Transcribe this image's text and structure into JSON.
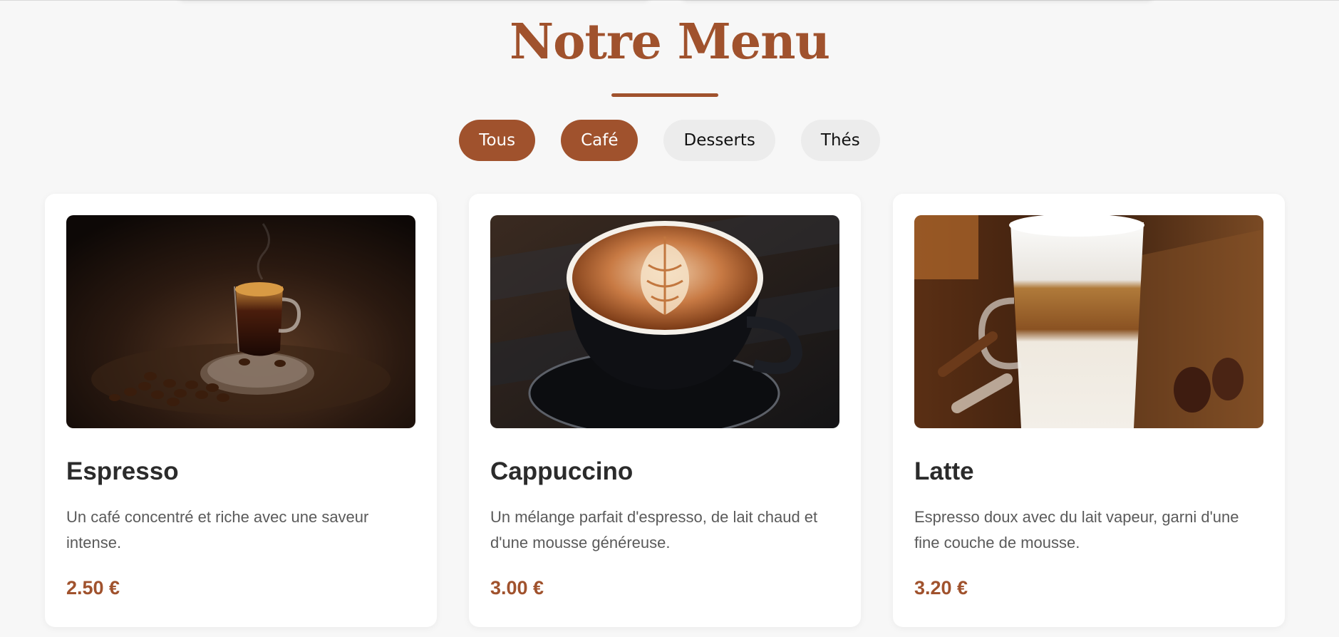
{
  "menu": {
    "title": "Notre Menu",
    "filters": [
      {
        "label": "Tous",
        "state": "active"
      },
      {
        "label": "Café",
        "state": "active"
      },
      {
        "label": "Desserts",
        "state": "inactive"
      },
      {
        "label": "Thés",
        "state": "inactive"
      }
    ],
    "items": [
      {
        "name": "Espresso",
        "description": "Un café concentré et riche avec une saveur intense.",
        "price": "2.50 €",
        "image": "espresso-cup-photo"
      },
      {
        "name": "Cappuccino",
        "description": "Un mélange parfait d'espresso, de lait chaud et d'une mousse généreuse.",
        "price": "3.00 €",
        "image": "cappuccino-latte-art-photo"
      },
      {
        "name": "Latte",
        "description": "Espresso doux avec du lait vapeur, garni d'une fine couche de mousse.",
        "price": "3.20 €",
        "image": "latte-glass-photo"
      }
    ]
  },
  "colors": {
    "accent": "#a0522d",
    "background": "#f7f7f7",
    "card": "#ffffff",
    "inactive_filter": "#ececec"
  }
}
